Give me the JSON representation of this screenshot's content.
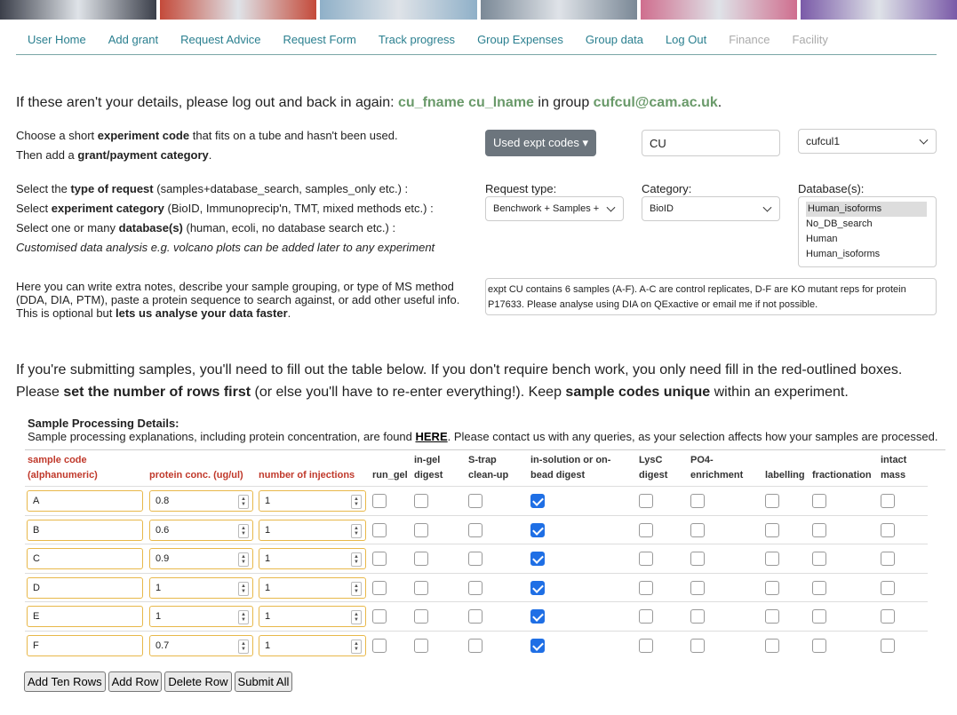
{
  "banner": {
    "colors": [
      "#3b3f4a",
      "#c44a3a",
      "#8fb0c8",
      "#7a8896",
      "#cf6e8e",
      "#7a5aa8"
    ]
  },
  "nav": [
    {
      "label": "User Home",
      "disabled": false
    },
    {
      "label": "Add grant",
      "disabled": false
    },
    {
      "label": "Request Advice",
      "disabled": false
    },
    {
      "label": "Request Form",
      "disabled": false
    },
    {
      "label": "Track progress",
      "disabled": false
    },
    {
      "label": "Group Expenses",
      "disabled": false
    },
    {
      "label": "Group data",
      "disabled": false
    },
    {
      "label": "Log Out",
      "disabled": false
    },
    {
      "label": "Finance",
      "disabled": true
    },
    {
      "label": "Facility",
      "disabled": true
    }
  ],
  "details": {
    "prefix": "If these aren't your details, please log out and back in again: ",
    "name": "cu_fname cu_lname",
    "mid": " in group ",
    "group": "cufcul@cam.ac.uk",
    "end": "."
  },
  "instructions": {
    "code1_a": "Choose a short ",
    "code1_b": "experiment code",
    "code1_c": " that fits on a tube and hasn't been used.",
    "code2_a": "Then add a ",
    "code2_b": "grant/payment category",
    "code2_c": ".",
    "req_a": "Select the ",
    "req_b": "type of request",
    "req_c": " (samples+database_search, samples_only etc.) :",
    "cat_a": "Select ",
    "cat_b": "experiment category",
    "cat_c": " (BioID, Immunoprecip'n, TMT, mixed methods etc.) :",
    "db_a": "Select one or many ",
    "db_b": "database(s)",
    "db_c": " (human, ecoli, no database search etc.) :",
    "custom": "Customised data analysis e.g. volcano plots can be added later to any experiment",
    "notes1": "Here you can write extra notes, describe your sample grouping, or type of MS method",
    "notes2": "(DDA, DIA, PTM), paste a protein sequence to search against, or add other useful info.",
    "notes3_a": "This is optional but ",
    "notes3_b": "lets us analyse your data faster",
    "notes3_c": "."
  },
  "form": {
    "used_codes_label": "Used expt codes ▾",
    "expt_code_value": "CU",
    "grant_value": "cufcul1",
    "request_type_label": "Request type:",
    "request_type_value": "Benchwork + Samples +",
    "category_label": "Category:",
    "category_value": "BioID",
    "database_label": "Database(s):",
    "databases": [
      "Human_isoforms",
      "No_DB_search",
      "Human",
      "Human_isoforms"
    ],
    "notes_value": "expt CU contains 6 samples (A-F). A-C are control replicates, D-F are KO mutant reps for protein P17633. Please analyse using DIA on QExactive or email me if not possible."
  },
  "table_intro": {
    "line1": "If you're submitting samples, you'll need to fill out the table below. If you don't require bench work, you only need fill in the red-outlined boxes.",
    "line2_a": "Please ",
    "line2_b": "set the number of rows first",
    "line2_c": " (or else you'll have to re-enter everything!). Keep ",
    "line2_d": "sample codes unique",
    "line2_e": " within an experiment."
  },
  "table": {
    "title": "Sample Processing Details:",
    "subtitle_a": "Sample processing explanations, including protein concentration, are found ",
    "subtitle_link": "HERE",
    "subtitle_b": ". Please contact us with any queries, as your selection affects how your samples are processed.",
    "headers": {
      "sample_code": [
        "sample code",
        "(alphanumeric)"
      ],
      "protein_conc": "protein conc. (ug/ul)",
      "injections": "number of injections",
      "run_gel": "run_gel",
      "in_gel": [
        "in-gel",
        "digest"
      ],
      "strap": [
        "S-trap",
        "clean-up"
      ],
      "in_solution": [
        "in-solution or on-",
        "bead digest"
      ],
      "lysc": [
        "LysC",
        "digest"
      ],
      "po4": [
        "PO4-",
        "enrichment"
      ],
      "labelling": "labelling",
      "fractionation": "fractionation",
      "intact": [
        "intact",
        "mass"
      ]
    },
    "rows": [
      {
        "code": "A",
        "conc": "0.8",
        "inj": "1",
        "in_solution": true
      },
      {
        "code": "B",
        "conc": "0.6",
        "inj": "1",
        "in_solution": true
      },
      {
        "code": "C",
        "conc": "0.9",
        "inj": "1",
        "in_solution": true
      },
      {
        "code": "D",
        "conc": "1",
        "inj": "1",
        "in_solution": true
      },
      {
        "code": "E",
        "conc": "1",
        "inj": "1",
        "in_solution": true
      },
      {
        "code": "F",
        "conc": "0.7",
        "inj": "1",
        "in_solution": true
      }
    ]
  },
  "buttons": {
    "add_ten": "Add Ten Rows",
    "add_row": "Add Row",
    "delete_row": "Delete Row",
    "submit_all": "Submit All"
  }
}
